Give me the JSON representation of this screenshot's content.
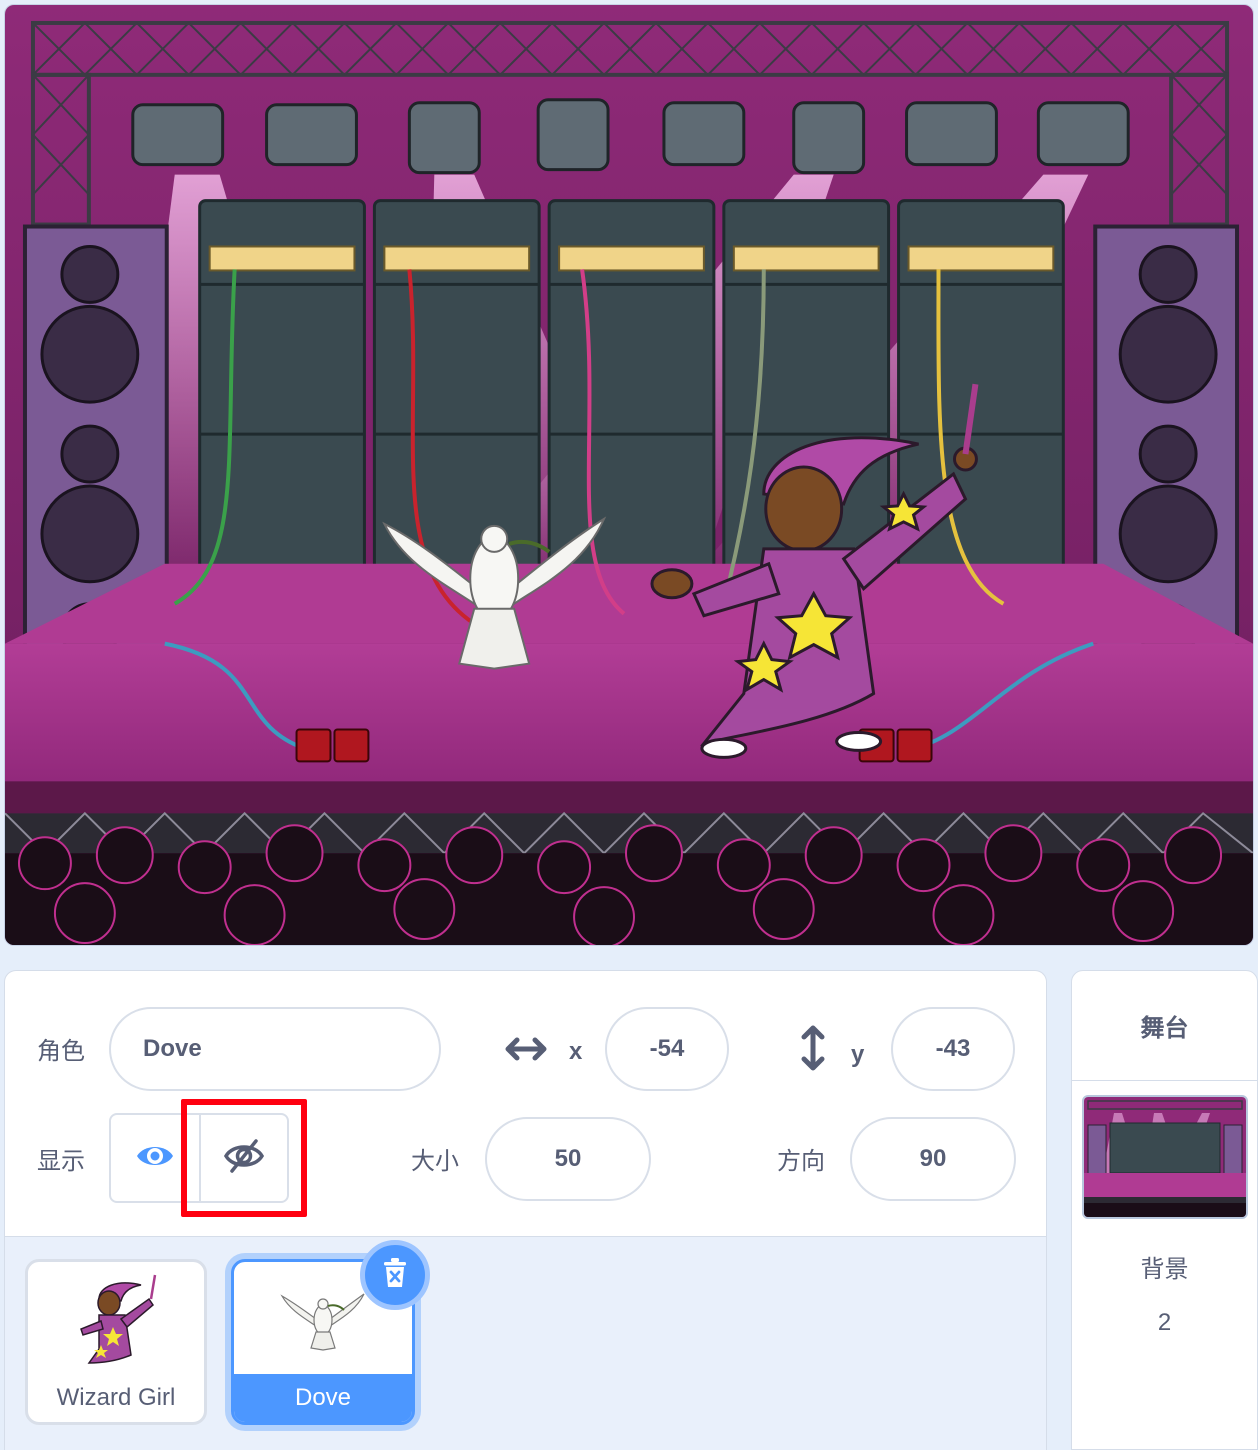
{
  "sprite_info": {
    "sprite_label": "角色",
    "sprite_name": "Dove",
    "x_label": "x",
    "x_value": "-54",
    "y_label": "y",
    "y_value": "-43",
    "show_label": "显示",
    "size_label": "大小",
    "size_value": "50",
    "direction_label": "方向",
    "direction_value": "90",
    "visibility": "hidden",
    "highlight_color": "#ff0010"
  },
  "sprites": [
    {
      "name": "Wizard Girl",
      "selected": false
    },
    {
      "name": "Dove",
      "selected": true
    }
  ],
  "stage_panel": {
    "title": "舞台",
    "backdrops_label": "背景",
    "backdrops_count": "2"
  },
  "icons": {
    "show": "eye-icon",
    "hide": "eye-slash-icon",
    "x_axis": "horizontal-arrows-icon",
    "y_axis": "vertical-arrows-icon",
    "delete": "trash-icon"
  },
  "colors": {
    "accent": "#4c97ff",
    "text": "#575e75",
    "stage_backdrop": "#a0327f"
  }
}
